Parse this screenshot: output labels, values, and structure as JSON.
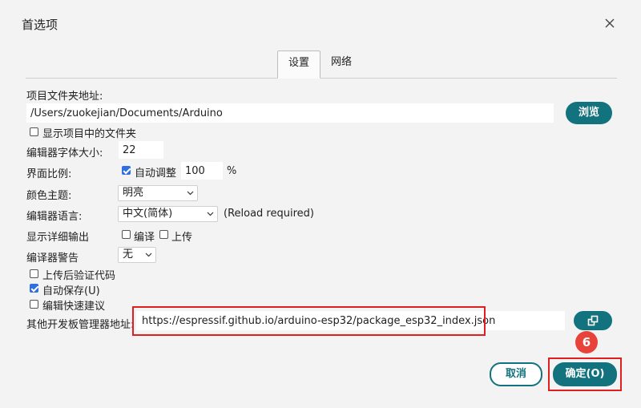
{
  "window": {
    "title": "首选项"
  },
  "tabs": [
    {
      "label": "设置",
      "active": true
    },
    {
      "label": "网络",
      "active": false
    }
  ],
  "sketchbook": {
    "label": "项目文件夹地址:",
    "value": "/Users/zuokejian/Documents/Arduino",
    "browse_label": "浏览"
  },
  "show_files": {
    "label": "显示项目中的文件夹",
    "checked": false
  },
  "font_size": {
    "label": "编辑器字体大小:",
    "value": "22"
  },
  "scale": {
    "label": "界面比例:",
    "auto_label": "自动调整",
    "auto_checked": true,
    "value": "100",
    "unit": "%"
  },
  "theme": {
    "label": "颜色主题:",
    "value": "明亮"
  },
  "language": {
    "label": "编辑器语言:",
    "value": "中文(简体)",
    "note": "(Reload required)"
  },
  "verbose": {
    "label": "显示详细输出",
    "compile_label": "编译",
    "compile_checked": false,
    "upload_label": "上传",
    "upload_checked": false
  },
  "warnings": {
    "label": "编译器警告",
    "value": "无"
  },
  "verify_after_upload": {
    "label": "上传后验证代码",
    "checked": false
  },
  "autosave": {
    "label": "自动保存(U)",
    "checked": true
  },
  "quick_suggestions": {
    "label": "编辑快速建议",
    "checked": false
  },
  "board_urls": {
    "label": "其他开发板管理器地址:",
    "value": "https://espressif.github.io/arduino-esp32/package_esp32_index.json"
  },
  "footer": {
    "cancel_label": "取消",
    "ok_label": "确定(O)"
  },
  "annotation": {
    "step": "6"
  },
  "colors": {
    "accent": "#12737e",
    "highlight": "#e02020",
    "check": "#2f6fe0",
    "badge": "#e8433b"
  }
}
